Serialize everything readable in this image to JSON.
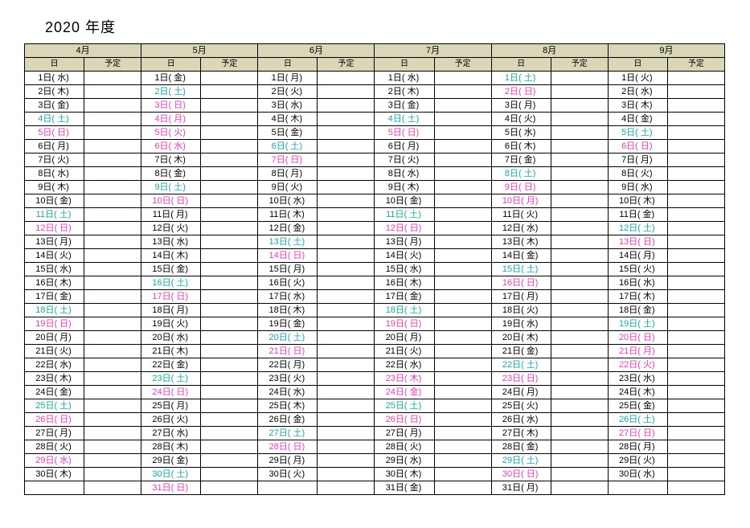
{
  "title": "2020  年度",
  "subheaders": {
    "day": "日",
    "plan": "予定"
  },
  "months": [
    {
      "label": "4月",
      "days": [
        {
          "t": "1日( 水)",
          "c": "black"
        },
        {
          "t": "2日( 木)",
          "c": "black"
        },
        {
          "t": "3日( 金)",
          "c": "black"
        },
        {
          "t": "4日( 土)",
          "c": "blue"
        },
        {
          "t": "5日( 日)",
          "c": "pink"
        },
        {
          "t": "6日( 月)",
          "c": "black"
        },
        {
          "t": "7日( 火)",
          "c": "black"
        },
        {
          "t": "8日( 水)",
          "c": "black"
        },
        {
          "t": "9日( 木)",
          "c": "black"
        },
        {
          "t": "10日( 金)",
          "c": "black"
        },
        {
          "t": "11日( 土)",
          "c": "blue"
        },
        {
          "t": "12日( 日)",
          "c": "pink"
        },
        {
          "t": "13日( 月)",
          "c": "black"
        },
        {
          "t": "14日( 火)",
          "c": "black"
        },
        {
          "t": "15日( 水)",
          "c": "black"
        },
        {
          "t": "16日( 木)",
          "c": "black"
        },
        {
          "t": "17日( 金)",
          "c": "black"
        },
        {
          "t": "18日( 土)",
          "c": "blue"
        },
        {
          "t": "19日( 日)",
          "c": "pink"
        },
        {
          "t": "20日( 月)",
          "c": "black"
        },
        {
          "t": "21日( 火)",
          "c": "black"
        },
        {
          "t": "22日( 水)",
          "c": "black"
        },
        {
          "t": "23日( 木)",
          "c": "black"
        },
        {
          "t": "24日( 金)",
          "c": "black"
        },
        {
          "t": "25日( 土)",
          "c": "blue"
        },
        {
          "t": "26日( 日)",
          "c": "pink"
        },
        {
          "t": "27日( 月)",
          "c": "black"
        },
        {
          "t": "28日( 火)",
          "c": "black"
        },
        {
          "t": "29日( 水)",
          "c": "pink"
        },
        {
          "t": "30日( 木)",
          "c": "black"
        },
        {
          "t": "",
          "c": "black"
        }
      ]
    },
    {
      "label": "5月",
      "days": [
        {
          "t": "1日( 金)",
          "c": "black"
        },
        {
          "t": "2日( 土)",
          "c": "blue"
        },
        {
          "t": "3日( 日)",
          "c": "pink"
        },
        {
          "t": "4日( 月)",
          "c": "pink"
        },
        {
          "t": "5日( 火)",
          "c": "pink"
        },
        {
          "t": "6日( 水)",
          "c": "pink"
        },
        {
          "t": "7日( 木)",
          "c": "black"
        },
        {
          "t": "8日( 金)",
          "c": "black"
        },
        {
          "t": "9日( 土)",
          "c": "blue"
        },
        {
          "t": "10日( 日)",
          "c": "pink"
        },
        {
          "t": "11日( 月)",
          "c": "black"
        },
        {
          "t": "12日( 火)",
          "c": "black"
        },
        {
          "t": "13日( 水)",
          "c": "black"
        },
        {
          "t": "14日( 木)",
          "c": "black"
        },
        {
          "t": "15日( 金)",
          "c": "black"
        },
        {
          "t": "16日( 土)",
          "c": "blue"
        },
        {
          "t": "17日( 日)",
          "c": "pink"
        },
        {
          "t": "18日( 月)",
          "c": "black"
        },
        {
          "t": "19日( 火)",
          "c": "black"
        },
        {
          "t": "20日( 水)",
          "c": "black"
        },
        {
          "t": "21日( 木)",
          "c": "black"
        },
        {
          "t": "22日( 金)",
          "c": "black"
        },
        {
          "t": "23日( 土)",
          "c": "blue"
        },
        {
          "t": "24日( 日)",
          "c": "pink"
        },
        {
          "t": "25日( 月)",
          "c": "black"
        },
        {
          "t": "26日( 火)",
          "c": "black"
        },
        {
          "t": "27日( 水)",
          "c": "black"
        },
        {
          "t": "28日( 木)",
          "c": "black"
        },
        {
          "t": "29日( 金)",
          "c": "black"
        },
        {
          "t": "30日( 土)",
          "c": "blue"
        },
        {
          "t": "31日( 日)",
          "c": "pink"
        }
      ]
    },
    {
      "label": "6月",
      "days": [
        {
          "t": "1日( 月)",
          "c": "black"
        },
        {
          "t": "2日( 火)",
          "c": "black"
        },
        {
          "t": "3日( 水)",
          "c": "black"
        },
        {
          "t": "4日( 木)",
          "c": "black"
        },
        {
          "t": "5日( 金)",
          "c": "black"
        },
        {
          "t": "6日( 土)",
          "c": "blue"
        },
        {
          "t": "7日( 日)",
          "c": "pink"
        },
        {
          "t": "8日( 月)",
          "c": "black"
        },
        {
          "t": "9日( 火)",
          "c": "black"
        },
        {
          "t": "10日( 水)",
          "c": "black"
        },
        {
          "t": "11日( 木)",
          "c": "black"
        },
        {
          "t": "12日( 金)",
          "c": "black"
        },
        {
          "t": "13日( 土)",
          "c": "blue"
        },
        {
          "t": "14日( 日)",
          "c": "pink"
        },
        {
          "t": "15日( 月)",
          "c": "black"
        },
        {
          "t": "16日( 火)",
          "c": "black"
        },
        {
          "t": "17日( 水)",
          "c": "black"
        },
        {
          "t": "18日( 木)",
          "c": "black"
        },
        {
          "t": "19日( 金)",
          "c": "black"
        },
        {
          "t": "20日( 土)",
          "c": "blue"
        },
        {
          "t": "21日( 日)",
          "c": "pink"
        },
        {
          "t": "22日( 月)",
          "c": "black"
        },
        {
          "t": "23日( 火)",
          "c": "black"
        },
        {
          "t": "24日( 水)",
          "c": "black"
        },
        {
          "t": "25日( 木)",
          "c": "black"
        },
        {
          "t": "26日( 金)",
          "c": "black"
        },
        {
          "t": "27日( 土)",
          "c": "blue"
        },
        {
          "t": "28日( 日)",
          "c": "pink"
        },
        {
          "t": "29日( 月)",
          "c": "black"
        },
        {
          "t": "30日( 火)",
          "c": "black"
        },
        {
          "t": "",
          "c": "black"
        }
      ]
    },
    {
      "label": "7月",
      "days": [
        {
          "t": "1日( 水)",
          "c": "black"
        },
        {
          "t": "2日( 木)",
          "c": "black"
        },
        {
          "t": "3日( 金)",
          "c": "black"
        },
        {
          "t": "4日( 土)",
          "c": "blue"
        },
        {
          "t": "5日( 日)",
          "c": "pink"
        },
        {
          "t": "6日( 月)",
          "c": "black"
        },
        {
          "t": "7日( 火)",
          "c": "black"
        },
        {
          "t": "8日( 水)",
          "c": "black"
        },
        {
          "t": "9日( 木)",
          "c": "black"
        },
        {
          "t": "10日( 金)",
          "c": "black"
        },
        {
          "t": "11日( 土)",
          "c": "blue"
        },
        {
          "t": "12日( 日)",
          "c": "pink"
        },
        {
          "t": "13日( 月)",
          "c": "black"
        },
        {
          "t": "14日( 火)",
          "c": "black"
        },
        {
          "t": "15日( 水)",
          "c": "black"
        },
        {
          "t": "16日( 木)",
          "c": "black"
        },
        {
          "t": "17日( 金)",
          "c": "black"
        },
        {
          "t": "18日( 土)",
          "c": "blue"
        },
        {
          "t": "19日( 日)",
          "c": "pink"
        },
        {
          "t": "20日( 月)",
          "c": "black"
        },
        {
          "t": "21日( 火)",
          "c": "black"
        },
        {
          "t": "22日( 水)",
          "c": "black"
        },
        {
          "t": "23日( 木)",
          "c": "pink"
        },
        {
          "t": "24日( 金)",
          "c": "pink"
        },
        {
          "t": "25日( 土)",
          "c": "blue"
        },
        {
          "t": "26日( 日)",
          "c": "pink"
        },
        {
          "t": "27日( 月)",
          "c": "black"
        },
        {
          "t": "28日( 火)",
          "c": "black"
        },
        {
          "t": "29日( 水)",
          "c": "black"
        },
        {
          "t": "30日( 木)",
          "c": "black"
        },
        {
          "t": "31日( 金)",
          "c": "black"
        }
      ]
    },
    {
      "label": "8月",
      "days": [
        {
          "t": "1日( 土)",
          "c": "blue"
        },
        {
          "t": "2日( 日)",
          "c": "pink"
        },
        {
          "t": "3日( 月)",
          "c": "black"
        },
        {
          "t": "4日( 火)",
          "c": "black"
        },
        {
          "t": "5日( 水)",
          "c": "black"
        },
        {
          "t": "6日( 木)",
          "c": "black"
        },
        {
          "t": "7日( 金)",
          "c": "black"
        },
        {
          "t": "8日( 土)",
          "c": "blue"
        },
        {
          "t": "9日( 日)",
          "c": "pink"
        },
        {
          "t": "10日( 月)",
          "c": "pink"
        },
        {
          "t": "11日( 火)",
          "c": "black"
        },
        {
          "t": "12日( 水)",
          "c": "black"
        },
        {
          "t": "13日( 木)",
          "c": "black"
        },
        {
          "t": "14日( 金)",
          "c": "black"
        },
        {
          "t": "15日( 土)",
          "c": "blue"
        },
        {
          "t": "16日( 日)",
          "c": "pink"
        },
        {
          "t": "17日( 月)",
          "c": "black"
        },
        {
          "t": "18日( 火)",
          "c": "black"
        },
        {
          "t": "19日( 水)",
          "c": "black"
        },
        {
          "t": "20日( 木)",
          "c": "black"
        },
        {
          "t": "21日( 金)",
          "c": "black"
        },
        {
          "t": "22日( 土)",
          "c": "blue"
        },
        {
          "t": "23日( 日)",
          "c": "pink"
        },
        {
          "t": "24日( 月)",
          "c": "black"
        },
        {
          "t": "25日( 火)",
          "c": "black"
        },
        {
          "t": "26日( 水)",
          "c": "black"
        },
        {
          "t": "27日( 木)",
          "c": "black"
        },
        {
          "t": "28日( 金)",
          "c": "black"
        },
        {
          "t": "29日( 土)",
          "c": "blue"
        },
        {
          "t": "30日( 日)",
          "c": "pink"
        },
        {
          "t": "31日( 月)",
          "c": "black"
        }
      ]
    },
    {
      "label": "9月",
      "days": [
        {
          "t": "1日( 火)",
          "c": "black"
        },
        {
          "t": "2日( 水)",
          "c": "black"
        },
        {
          "t": "3日( 木)",
          "c": "black"
        },
        {
          "t": "4日( 金)",
          "c": "black"
        },
        {
          "t": "5日( 土)",
          "c": "blue"
        },
        {
          "t": "6日( 日)",
          "c": "pink"
        },
        {
          "t": "7日( 月)",
          "c": "black"
        },
        {
          "t": "8日( 火)",
          "c": "black"
        },
        {
          "t": "9日( 水)",
          "c": "black"
        },
        {
          "t": "10日( 木)",
          "c": "black"
        },
        {
          "t": "11日( 金)",
          "c": "black"
        },
        {
          "t": "12日( 土)",
          "c": "blue"
        },
        {
          "t": "13日( 日)",
          "c": "pink"
        },
        {
          "t": "14日( 月)",
          "c": "black"
        },
        {
          "t": "15日( 火)",
          "c": "black"
        },
        {
          "t": "16日( 水)",
          "c": "black"
        },
        {
          "t": "17日( 木)",
          "c": "black"
        },
        {
          "t": "18日( 金)",
          "c": "black"
        },
        {
          "t": "19日( 土)",
          "c": "blue"
        },
        {
          "t": "20日( 日)",
          "c": "pink"
        },
        {
          "t": "21日( 月)",
          "c": "pink"
        },
        {
          "t": "22日( 火)",
          "c": "pink"
        },
        {
          "t": "23日( 水)",
          "c": "black"
        },
        {
          "t": "24日( 木)",
          "c": "black"
        },
        {
          "t": "25日( 金)",
          "c": "black"
        },
        {
          "t": "26日( 土)",
          "c": "blue"
        },
        {
          "t": "27日( 日)",
          "c": "pink"
        },
        {
          "t": "28日( 月)",
          "c": "black"
        },
        {
          "t": "29日( 火)",
          "c": "black"
        },
        {
          "t": "30日( 水)",
          "c": "black"
        },
        {
          "t": "",
          "c": "black"
        }
      ]
    }
  ]
}
